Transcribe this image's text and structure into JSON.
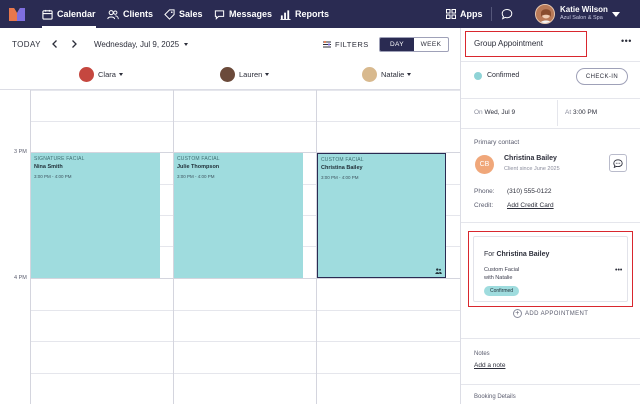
{
  "nav": {
    "items": [
      {
        "label": "Calendar",
        "icon": "calendar-icon"
      },
      {
        "label": "Clients",
        "icon": "people-icon"
      },
      {
        "label": "Sales",
        "icon": "tag-icon"
      },
      {
        "label": "Messages",
        "icon": "chat-icon"
      },
      {
        "label": "Reports",
        "icon": "bar-chart-icon"
      }
    ],
    "apps_label": "Apps",
    "user": {
      "name": "Katie Wilson",
      "business": "Azul Salon & Spa"
    }
  },
  "toolbar": {
    "today_label": "TODAY",
    "date": "Wednesday, Jul 9, 2025",
    "filters_label": "FILTERS",
    "view_day": "DAY",
    "view_week": "WEEK"
  },
  "staff": [
    {
      "name": "Clara",
      "color": "#c5473f"
    },
    {
      "name": "Lauren",
      "color": "#6b4a3a"
    },
    {
      "name": "Natalie",
      "color": "#d8b98e"
    }
  ],
  "grid": {
    "time_labels": [
      "3 PM",
      "4 PM"
    ]
  },
  "appointments": [
    {
      "service": "SIGNATURE FACIAL",
      "client": "Nina Smith",
      "time": "3:00 PM - 4:00 PM"
    },
    {
      "service": "CUSTOM FACIAL",
      "client": "Julie Thompson",
      "time": "3:00 PM - 4:00 PM"
    },
    {
      "service": "CUSTOM FACIAL",
      "client": "Christina Bailey",
      "time": "3:00 PM - 4:00 PM"
    }
  ],
  "panel": {
    "title": "Group Appointment",
    "status": "Confirmed",
    "checkin_label": "CHECK-IN",
    "on_label": "On",
    "date": "Wed, Jul 9",
    "at_label": "At",
    "time": "3:00 PM",
    "primary_contact_label": "Primary contact",
    "contact_initials": "CB",
    "contact_name": "Christina Bailey",
    "contact_since": "Client since June 2025",
    "phone_label": "Phone:",
    "phone": "(310) 555-0122",
    "credit_label": "Credit:",
    "credit_link": "Add Credit Card",
    "for_prefix": "For",
    "for_name": "Christina Bailey",
    "for_service": "Custom Facial",
    "for_with": "with Natalie",
    "for_status": "Confirmed",
    "add_appointment": "ADD APPOINTMENT",
    "notes_label": "Notes",
    "notes_link": "Add a note",
    "booking_label": "Booking Details"
  },
  "colors": {
    "nav_bg": "#2a2b52",
    "appointment": "#9fdcde",
    "highlight": "#d9272e",
    "avatar": "#f0a77a"
  }
}
